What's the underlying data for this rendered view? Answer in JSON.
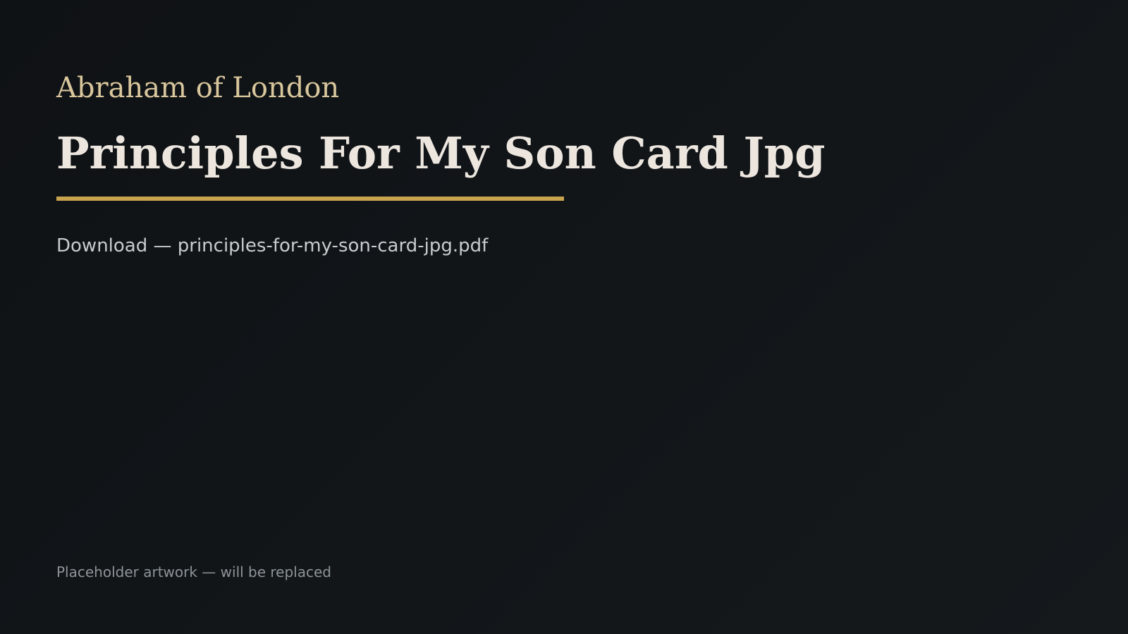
{
  "brand": "Abraham of London",
  "title": "Principles For My Son Card Jpg",
  "download_line": "Download — principles-for-my-son-card-jpg.pdf",
  "footer_note": "Placeholder artwork — will be replaced",
  "colors": {
    "background": "#121619",
    "brand": "#d8c69c",
    "title": "#ece6df",
    "accent_rule": "#c9a44f",
    "body_text": "#c8ccd0",
    "muted_text": "#8d9499"
  }
}
